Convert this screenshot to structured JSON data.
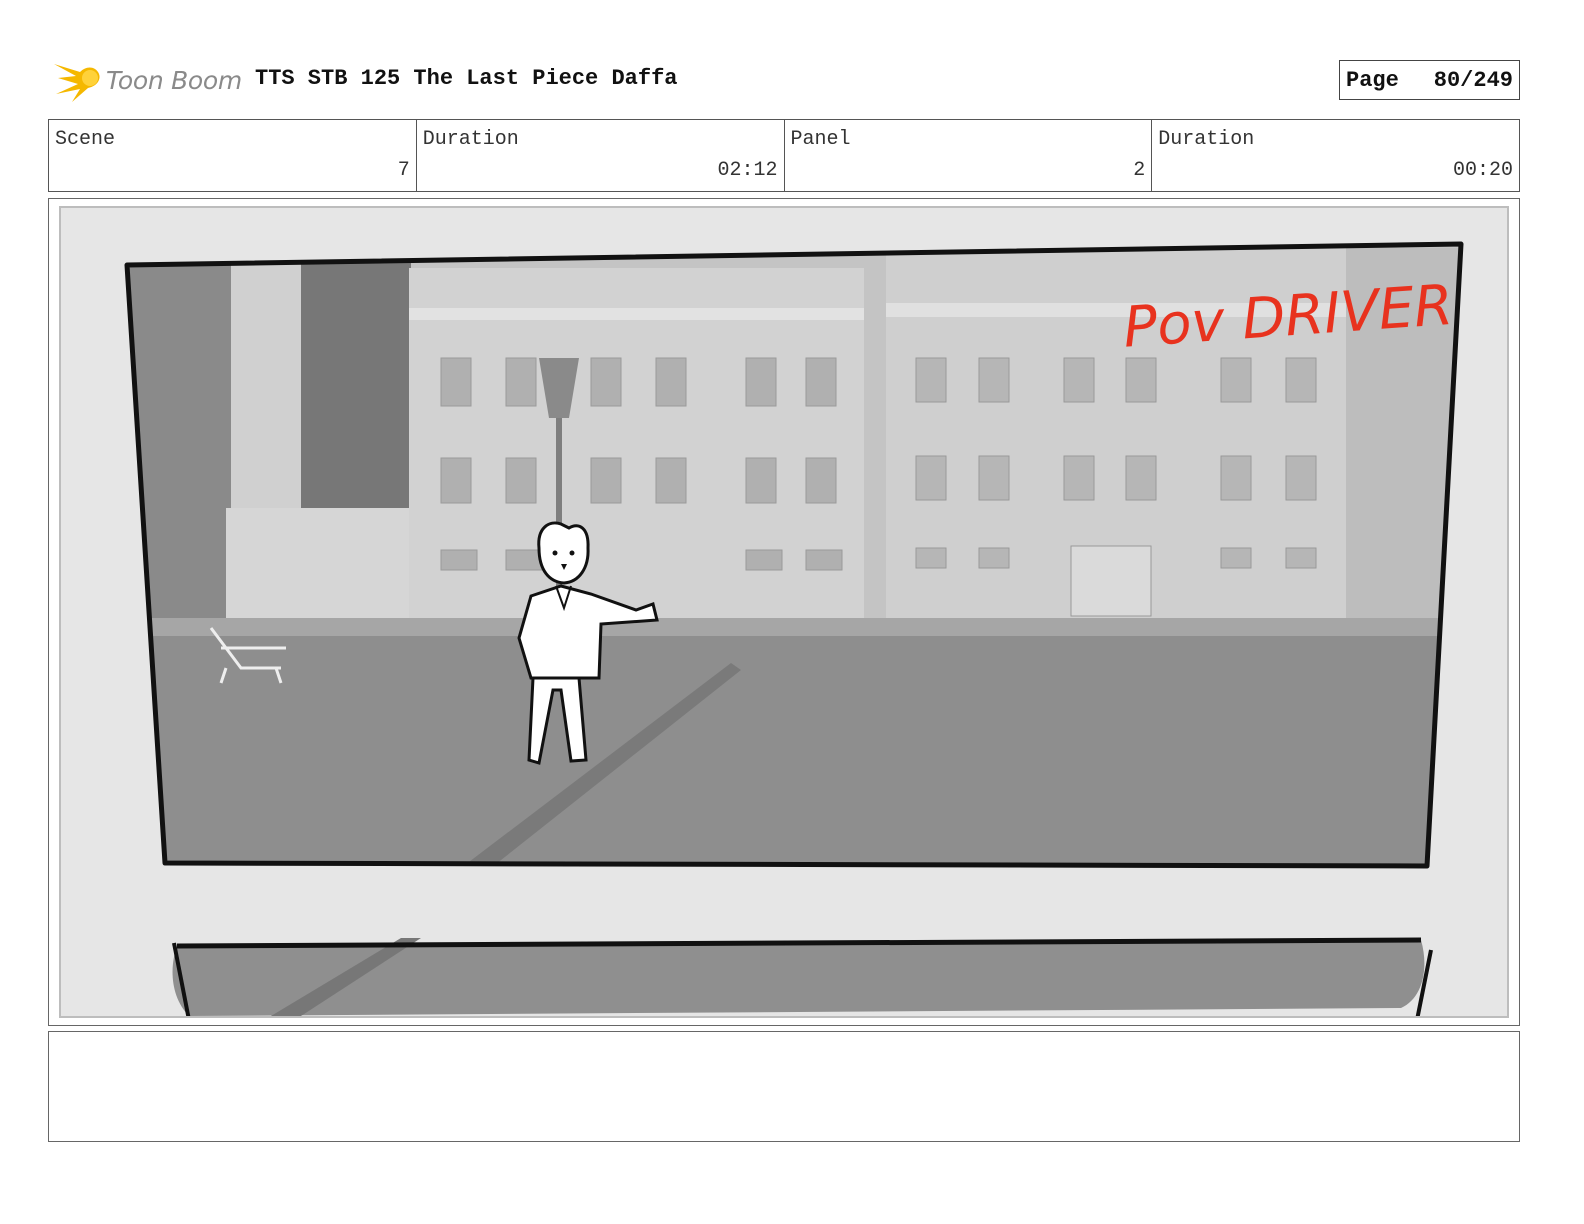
{
  "header": {
    "logo_text": "Toon Boom",
    "title": "TTS STB 125 The Last Piece Daffa",
    "page_label": "Page",
    "page_number": "80/249"
  },
  "info": [
    {
      "label": "Scene",
      "value": "7"
    },
    {
      "label": "Duration",
      "value": "02:12"
    },
    {
      "label": "Panel",
      "value": "2"
    },
    {
      "label": "Duration",
      "value": "00:20"
    }
  ],
  "panel": {
    "annotation": "Pov DRIVER",
    "annotation_color": "#e8321e"
  },
  "notes": {
    "text": ""
  },
  "colors": {
    "logo_flame": "#f5b800",
    "border": "#555555",
    "panel_bg": "#e6e6e6"
  }
}
